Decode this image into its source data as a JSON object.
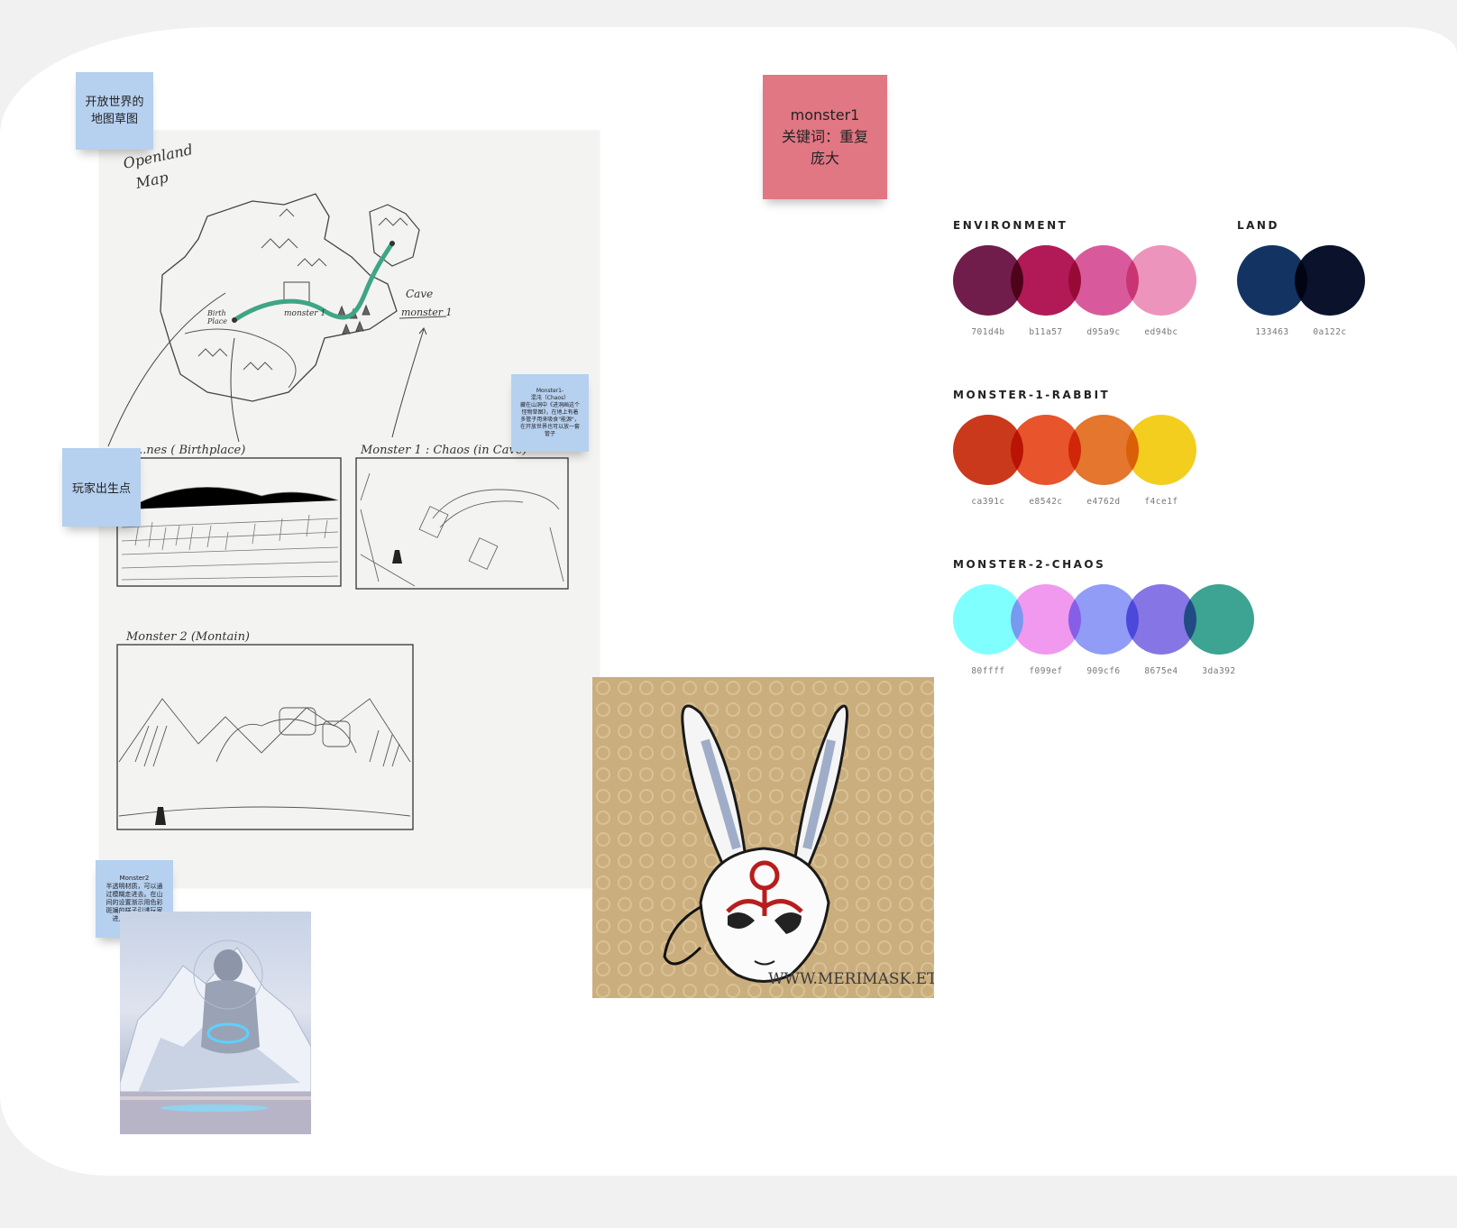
{
  "stickies": {
    "map_sketch": "开放世界的\n地图草图",
    "monster1": "monster1\n关键词：重复\n庞大",
    "birthplace": "玩家出生点",
    "monster1_note": "Monster1-\n混沌（Chaos）\n藏在山洞中《进洞画这个\n怪物草图》，在地上有着\n多管子用来吸食\"能源\"，\n在开放世界也可以放一套\n管子",
    "monster2_note": "Monster2\n半透明材质，可以通\n过模糊走进去。在山\n间的设置渐示用色彩\n斑斓的样子引诱玩家\n进入危险的区域"
  },
  "sketch": {
    "title_line1": "Openland",
    "title_line2": "Map",
    "birth_label": "Birth\nPlace",
    "monster1_label": "monster 1",
    "cave_label": "Cave",
    "cave_monster": "monster 1",
    "panel1_label": "...nes ( Birthplace)",
    "panel2_label": "Monster 1 : Chaos (in Cave)",
    "panel3_label": "Monster 2  (Montain)"
  },
  "photos": {
    "mask_watermark": "WWW.MERIMASK.ETSY.COM"
  },
  "palettes": [
    {
      "title": "ENVIRONMENT",
      "swatches": [
        {
          "hex": "#701d4b",
          "code": "701d4b"
        },
        {
          "hex": "#b11a57",
          "code": "b11a57"
        },
        {
          "hex": "#d95a9c",
          "code": "d95a9c"
        },
        {
          "hex": "#ed94bc",
          "code": "ed94bc"
        }
      ]
    },
    {
      "title": "LAND",
      "swatches": [
        {
          "hex": "#133463",
          "code": "133463"
        },
        {
          "hex": "#0a122c",
          "code": "0a122c"
        }
      ]
    },
    {
      "title": "MONSTER-1-RABBIT",
      "swatches": [
        {
          "hex": "#ca391c",
          "code": "ca391c"
        },
        {
          "hex": "#e8542c",
          "code": "e8542c"
        },
        {
          "hex": "#e4762d",
          "code": "e4762d"
        },
        {
          "hex": "#f4ce1f",
          "code": "f4ce1f"
        }
      ]
    },
    {
      "title": "MONSTER-2-CHAOS",
      "swatches": [
        {
          "hex": "#80ffff",
          "code": "80ffff"
        },
        {
          "hex": "#f099ef",
          "code": "f099ef"
        },
        {
          "hex": "#909cf6",
          "code": "909cf6"
        },
        {
          "hex": "#8675e4",
          "code": "8675e4"
        },
        {
          "hex": "#3da392",
          "code": "3da392"
        }
      ]
    }
  ]
}
